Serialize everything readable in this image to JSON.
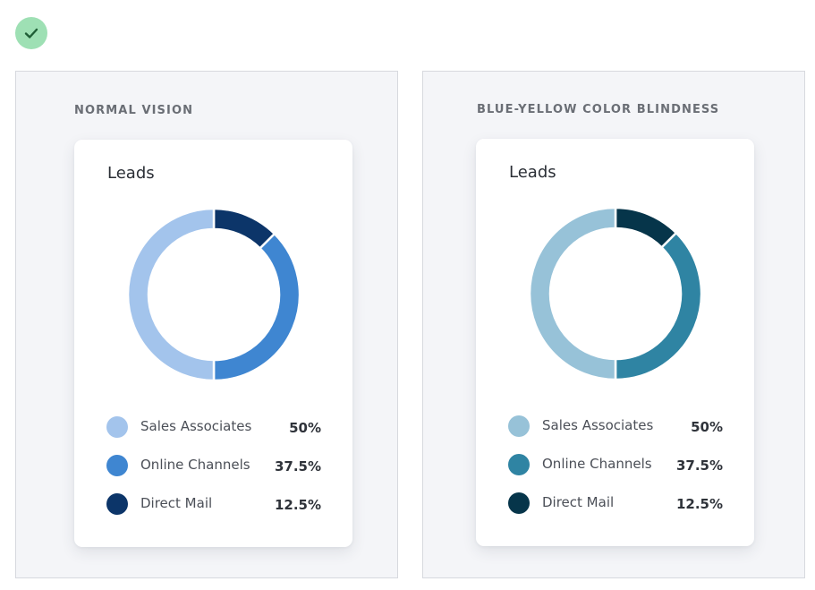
{
  "status": {
    "icon": "check-icon",
    "color": "#9ee0b4",
    "icon_color": "#1f5e36"
  },
  "chart_data": [
    {
      "type": "pie",
      "panel_label": "NORMAL VISION",
      "title": "Leads",
      "categories": [
        "Sales Associates",
        "Online Channels",
        "Direct Mail"
      ],
      "values": [
        50,
        37.5,
        12.5
      ],
      "value_labels": [
        "50%",
        "37.5%",
        "12.5%"
      ],
      "colors": [
        "#a3c4ec",
        "#3f86d1",
        "#0c3569"
      ],
      "donut": true,
      "start": "top",
      "direction": "clockwise_from_smallest",
      "legend_placement": "bottom"
    },
    {
      "type": "pie",
      "panel_label": "BLUE-YELLOW COLOR BLINDNESS",
      "title": "Leads",
      "categories": [
        "Sales Associates",
        "Online Channels",
        "Direct Mail"
      ],
      "values": [
        50,
        37.5,
        12.5
      ],
      "value_labels": [
        "50%",
        "37.5%",
        "12.5%"
      ],
      "colors": [
        "#97c2d8",
        "#2f84a3",
        "#06354a"
      ],
      "donut": true,
      "start": "top",
      "direction": "clockwise_from_smallest",
      "legend_placement": "bottom"
    }
  ]
}
